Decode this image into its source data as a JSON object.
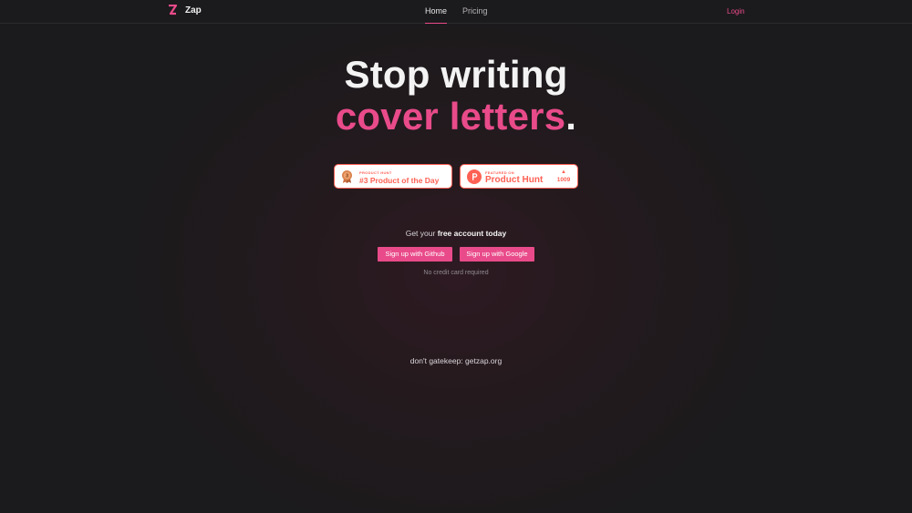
{
  "nav": {
    "brand": "Zap",
    "links": [
      "Home",
      "Pricing"
    ],
    "login": "Login"
  },
  "hero": {
    "line1": "Stop writing",
    "line2": "cover letters",
    "line2_suffix": "."
  },
  "badges": [
    {
      "small": "PRODUCT HUNT",
      "big": "#3 Product of the Day",
      "icon": "medal-icon"
    },
    {
      "small": "FEATURED ON",
      "big": "Product Hunt",
      "votes": "1009",
      "icon": "product-hunt-logo-icon"
    }
  ],
  "cta": {
    "lead": "Get your ",
    "lead_bold": "free account today",
    "github_button": "Sign up with Github",
    "google_button": "Sign up with Google",
    "note": "No credit card required"
  },
  "footer": {
    "text": "don't gatekeep: getzap.org"
  },
  "colors": {
    "accent": "#e94b8a",
    "background": "#1b1a1c",
    "product_hunt": "#ff6154"
  }
}
